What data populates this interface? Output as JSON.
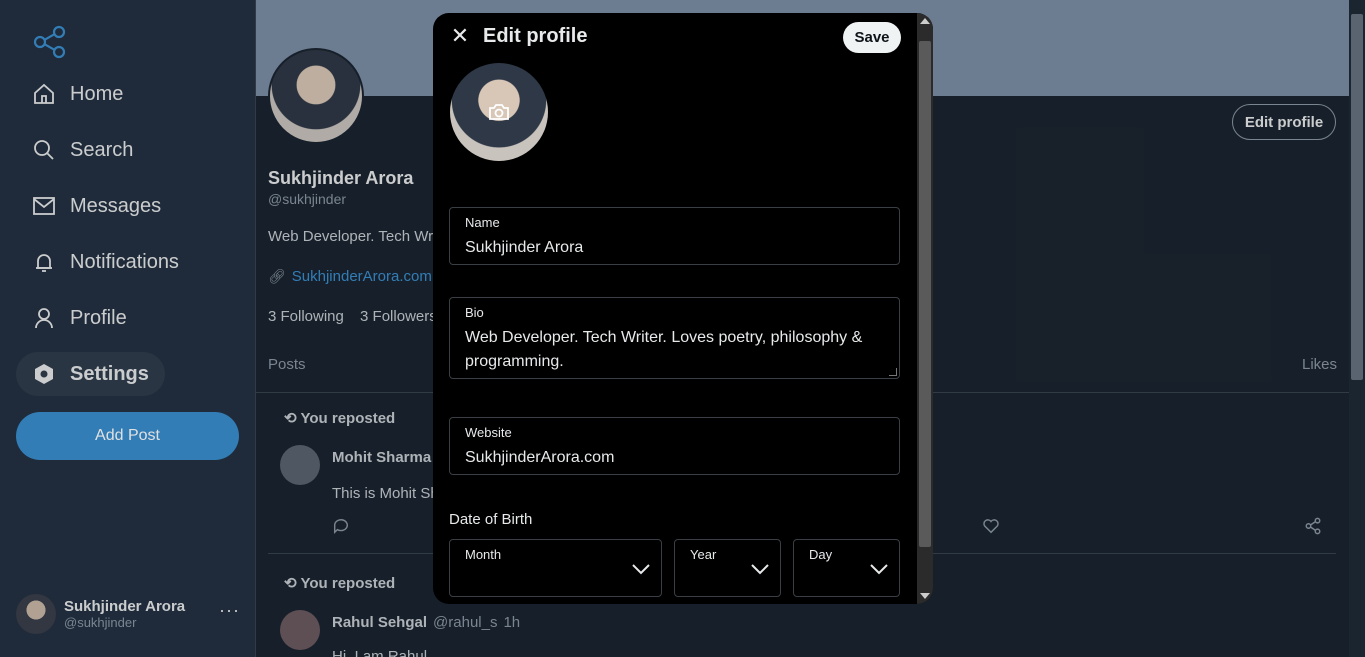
{
  "sidebar": {
    "items": [
      {
        "label": "Home",
        "icon": "home-icon"
      },
      {
        "label": "Search",
        "icon": "search-icon"
      },
      {
        "label": "Messages",
        "icon": "mail-icon"
      },
      {
        "label": "Notifications",
        "icon": "bell-icon"
      },
      {
        "label": "Profile",
        "icon": "user-icon"
      },
      {
        "label": "Settings",
        "icon": "settings-icon",
        "active": true
      }
    ],
    "add_post_label": "Add Post",
    "account": {
      "name": "Sukhjinder Arora",
      "handle": "@sukhjinder",
      "more": "···"
    }
  },
  "profile": {
    "name": "Sukhjinder Arora",
    "handle": "@sukhjinder",
    "bio": "Web Developer. Tech Wri",
    "website": "SukhjinderArora.com",
    "following": "3 Following",
    "followers": "3 Followers",
    "edit_label": "Edit profile",
    "tabs": {
      "posts": "Posts",
      "likes": "Likes"
    }
  },
  "posts": [
    {
      "repost_label": "You reposted",
      "author": "Mohit Sharma",
      "text": "This is Mohit Sh"
    },
    {
      "repost_label": "You reposted",
      "author": "Rahul Sehgal",
      "handle": "@rahul_s",
      "time": "1h",
      "text": "Hi, I am Rahul"
    }
  ],
  "modal": {
    "title": "Edit profile",
    "save_label": "Save",
    "fields": {
      "name": {
        "label": "Name",
        "value": "Sukhjinder Arora"
      },
      "bio": {
        "label": "Bio",
        "value": "Web Developer. Tech Writer. Loves poetry, philosophy & programming."
      },
      "website": {
        "label": "Website",
        "value": "SukhjinderArora.com"
      }
    },
    "dob": {
      "label": "Date of Birth",
      "month": "Month",
      "year": "Year",
      "day": "Day"
    }
  },
  "colors": {
    "accent": "#3a8fd0",
    "background": "#1b2530",
    "sidebar": "#243242",
    "modal": "#000000"
  }
}
